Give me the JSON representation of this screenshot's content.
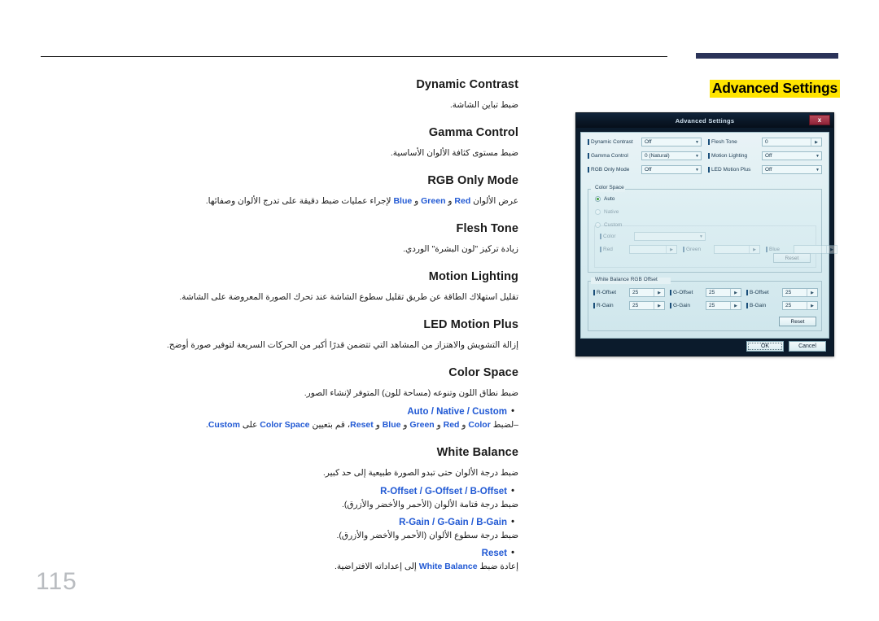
{
  "chapter": {
    "title": "Advanced Settings"
  },
  "page_number": "115",
  "sections": [
    {
      "title": "Dynamic Contrast",
      "desc": "ضبط تباين الشاشة."
    },
    {
      "title": "Gamma Control",
      "desc": "ضبط مستوى كثافة الألوان الأساسية."
    },
    {
      "title": "RGB Only Mode",
      "desc_pre": "عرض الألوان ",
      "kw1": "Red",
      "desc_mid1": " و ",
      "kw2": "Green",
      "desc_mid2": " و ",
      "kw3": "Blue",
      "desc_post": " لإجراء عمليات ضبط دقيقة على تدرج الألوان وصفائها."
    },
    {
      "title": "Flesh Tone",
      "desc": "زيادة تركيز \"لون البشرة\" الوردي."
    },
    {
      "title": "Motion Lighting",
      "desc": "تقليل استهلاك الطاقة عن طريق تقليل سطوع الشاشة عند تحرك الصورة المعروضة على الشاشة."
    },
    {
      "title": "LED Motion Plus",
      "desc": "إزالة التشويش والاهتزاز من المشاهد التي تتضمن قدرًا أكبر من الحركات السريعة لتوفير صورة أوضح."
    },
    {
      "title": "Color Space",
      "desc": "ضبط نطاق اللون وتنوعه (مساحة للون) المتوفر لإنشاء الصور.",
      "bullets": [
        {
          "label": "Auto / Native / Custom",
          "desc_parts": [
            "–لضبط ",
            "Color",
            " و ",
            "Red",
            " و ",
            "Green",
            " و ",
            "Blue",
            " و ",
            "Reset",
            "، قم بتعيين ",
            "Color Space",
            " على ",
            "Custom",
            "."
          ]
        }
      ]
    },
    {
      "title": "White Balance",
      "desc": "ضبط درجة الألوان حتى تبدو الصورة طبيعية إلى حد كبير.",
      "bullets": [
        {
          "label": "R-Offset / G-Offset / B-Offset",
          "desc": "ضبط درجة قتامة الألوان (الأحمر والأخضر والأزرق)."
        },
        {
          "label": "R-Gain / G-Gain / B-Gain",
          "desc": "ضبط درجة سطوع الألوان (الأحمر والأخضر والأزرق)."
        },
        {
          "label": "Reset",
          "desc_pre": "إعادة ضبط ",
          "kw": "White Balance",
          "desc_post": " إلى إعداداته الافتراضية."
        }
      ]
    }
  ],
  "dialog": {
    "title": "Advanced Settings",
    "close_label": "x",
    "fields": [
      {
        "label": "Dynamic Contrast",
        "value": "Off",
        "kind": "combo"
      },
      {
        "label": "Flesh Tone",
        "value": "0",
        "kind": "spin"
      },
      {
        "label": "Gamma Control",
        "value": "0 (Natural)",
        "kind": "combo"
      },
      {
        "label": "Motion Lighting",
        "value": "Off",
        "kind": "combo"
      },
      {
        "label": "RGB Only Mode",
        "value": "Off",
        "kind": "combo"
      },
      {
        "label": "LED Motion Plus",
        "value": "Off",
        "kind": "combo"
      }
    ],
    "color_space": {
      "legend": "Color Space",
      "options": [
        {
          "label": "Auto",
          "selected": true
        },
        {
          "label": "Native",
          "selected": false
        },
        {
          "label": "Custom",
          "selected": false
        }
      ],
      "custom": {
        "color_label": "Color",
        "color_value": "",
        "red_label": "Red",
        "red_value": "",
        "green_label": "Green",
        "green_value": "",
        "blue_label": "Blue",
        "blue_value": "",
        "reset_label": "Reset"
      }
    },
    "white_balance": {
      "legend": "White Balance RGB Offset",
      "items": [
        {
          "label": "R-Offset",
          "value": "25"
        },
        {
          "label": "G-Offset",
          "value": "25"
        },
        {
          "label": "B-Offset",
          "value": "25"
        },
        {
          "label": "R-Gain",
          "value": "25"
        },
        {
          "label": "G-Gain",
          "value": "25"
        },
        {
          "label": "B-Gain",
          "value": "25"
        }
      ],
      "reset_label": "Reset"
    },
    "ok_label": "OK",
    "cancel_label": "Cancel"
  },
  "colors": {
    "accent_blue": "#2159d4",
    "highlight_yellow": "#ffe400",
    "header_bar": "#2b3359",
    "page_number": "#b9bcc0"
  }
}
